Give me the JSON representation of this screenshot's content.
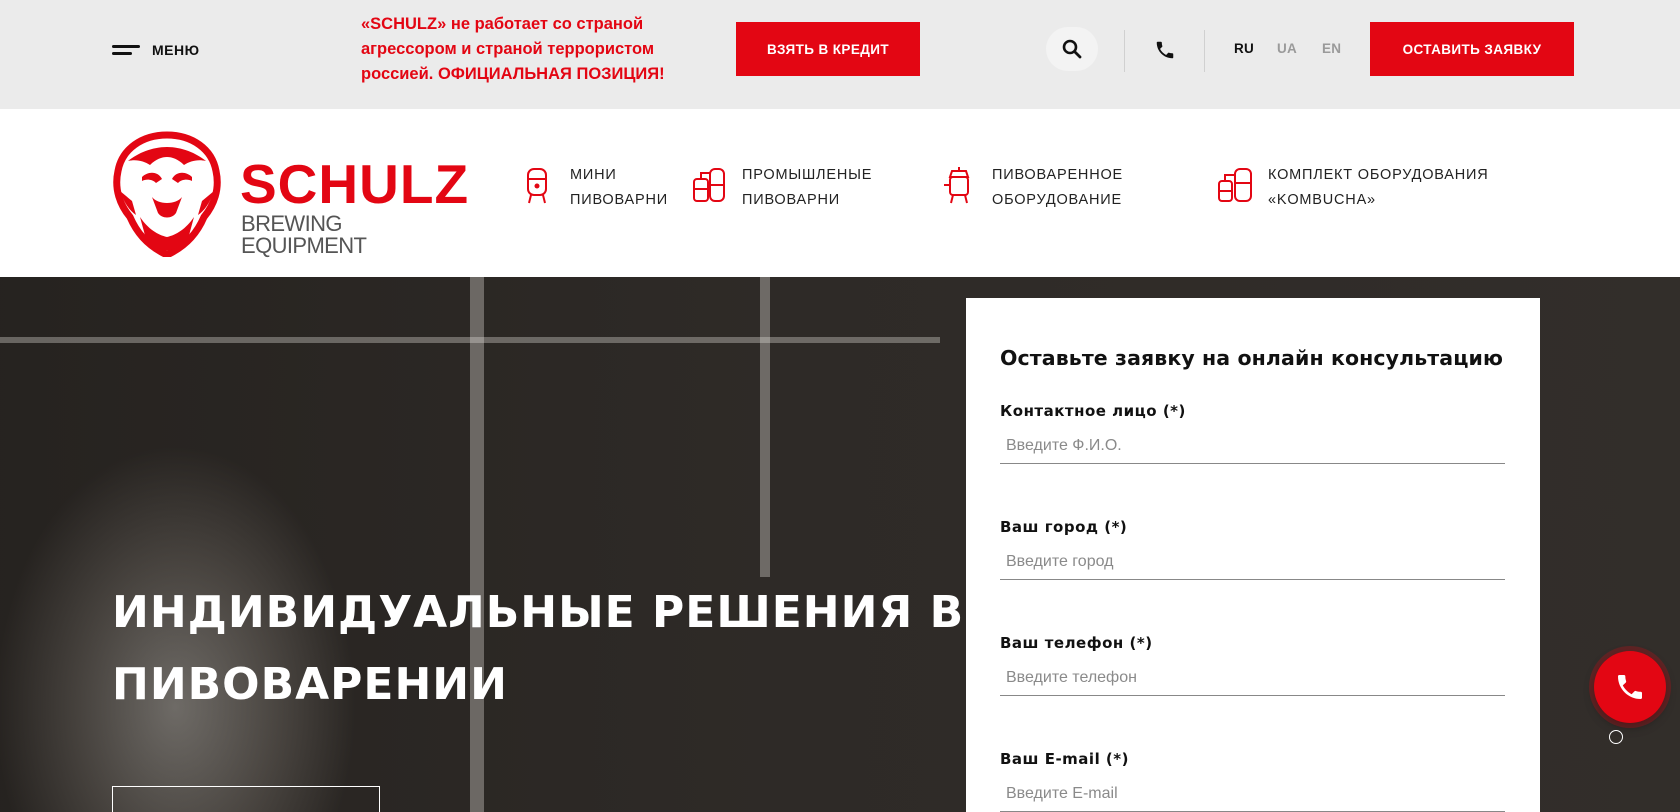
{
  "topbar": {
    "menu_label": "МЕНЮ",
    "notice_text": "«SCHULZ» не работает со страной агрессором и страной террористом россией.",
    "notice_link": "ОФИЦИАЛЬНАЯ ПОЗИЦИЯ!",
    "credit_button": "ВЗЯТЬ В КРЕДИТ",
    "request_button": "ОСТАВИТЬ ЗАЯВКУ",
    "languages": [
      "RU",
      "UA",
      "EN"
    ],
    "active_language": "RU",
    "icons": {
      "search": "search-icon",
      "phone": "phone-icon",
      "menu": "hamburger-icon"
    }
  },
  "logo": {
    "main": "SCHULZ",
    "sub": "BREWING EQUIPMENT"
  },
  "nav": {
    "items": [
      {
        "label": "МИНИ ПИВОВАРНИ",
        "icon": "mini-brewery-icon"
      },
      {
        "label": "ПРОМЫШЛЕНЫЕ ПИВОВАРНИ",
        "icon": "industrial-brewery-icon"
      },
      {
        "label": "ПИВОВАРЕННОЕ ОБОРУДОВАНИЕ",
        "icon": "brewing-equipment-icon"
      },
      {
        "label": "КОМПЛЕКТ ОБОРУДОВАНИЯ «KOMBUCHA»",
        "icon": "kombucha-kit-icon"
      }
    ]
  },
  "hero": {
    "title": "ИНДИВИДУАЛЬНЫЕ РЕШЕНИЯ В ПИВОВАРЕНИИ"
  },
  "form": {
    "title": "Оставьте заявку на онлайн консультацию",
    "fields": [
      {
        "label": "Контактное лицо (*)",
        "placeholder": "Введите Ф.И.О.",
        "value": ""
      },
      {
        "label": "Ваш город (*)",
        "placeholder": "Введите город",
        "value": ""
      },
      {
        "label": "Ваш телефон (*)",
        "placeholder": "Введите телефон",
        "value": ""
      },
      {
        "label": "Ваш E-mail (*)",
        "placeholder": "Введите E-mail",
        "value": ""
      }
    ]
  },
  "colors": {
    "brand_red": "#e30613",
    "topbar_bg": "#ebebeb",
    "inactive_lang": "#9a9a9a"
  }
}
